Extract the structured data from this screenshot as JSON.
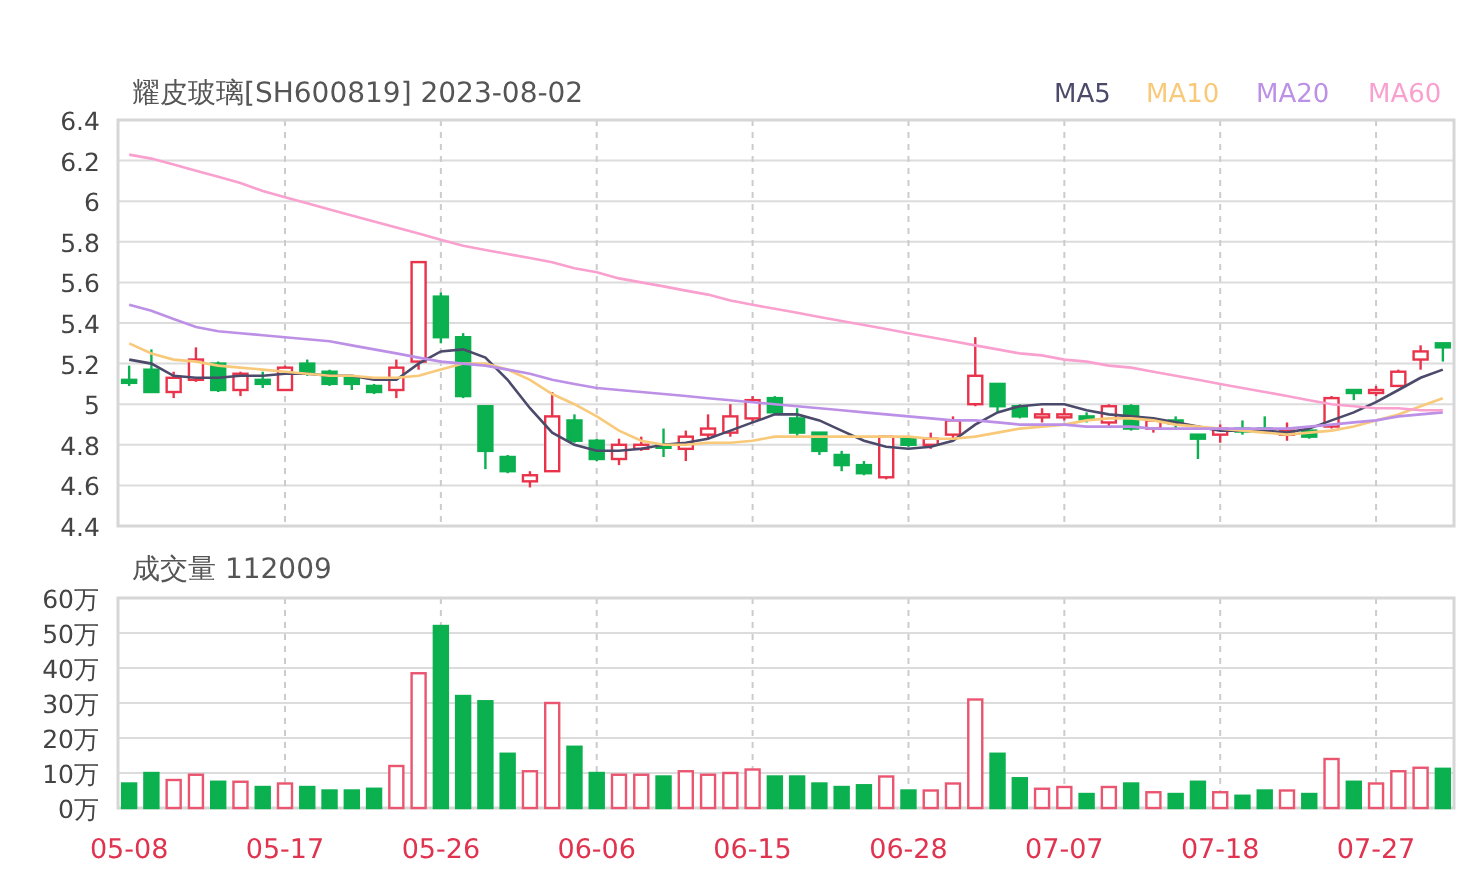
{
  "price_chart": {
    "chart_data": {
      "type": "candlestick",
      "title": "耀皮玻璃[SH600819] 2023-08-02",
      "ylim": [
        4.4,
        6.4
      ],
      "grid": true,
      "yticks": [
        4.4,
        4.6,
        4.8,
        5,
        5.2,
        5.4,
        5.6,
        5.8,
        6,
        6.2,
        6.4
      ],
      "categories": [
        null,
        null,
        null,
        null,
        null,
        null,
        null,
        null,
        null,
        null,
        null,
        null,
        null,
        null,
        null,
        null,
        null,
        null,
        null,
        null,
        null,
        null,
        null,
        null,
        null,
        null,
        null,
        null,
        null,
        null,
        null,
        null,
        null,
        null,
        null,
        null,
        null,
        null,
        null,
        null,
        null,
        null,
        null,
        null,
        null,
        null,
        null,
        null,
        null,
        null,
        null,
        null,
        null,
        null,
        null,
        null,
        null,
        null,
        null,
        null
      ],
      "ohlc": [
        [
          5.12,
          5.19,
          5.09,
          5.11
        ],
        [
          5.17,
          5.27,
          5.06,
          5.06
        ],
        [
          5.06,
          5.16,
          5.03,
          5.13
        ],
        [
          5.12,
          5.28,
          5.11,
          5.22
        ],
        [
          5.2,
          5.21,
          5.06,
          5.07
        ],
        [
          5.07,
          5.16,
          5.04,
          5.15
        ],
        [
          5.12,
          5.16,
          5.08,
          5.1
        ],
        [
          5.07,
          5.19,
          5.07,
          5.18
        ],
        [
          5.2,
          5.22,
          5.14,
          5.16
        ],
        [
          5.16,
          5.17,
          5.09,
          5.1
        ],
        [
          5.13,
          5.14,
          5.07,
          5.1
        ],
        [
          5.09,
          5.1,
          5.05,
          5.06
        ],
        [
          5.07,
          5.22,
          5.03,
          5.18
        ],
        [
          5.21,
          5.7,
          5.17,
          5.7
        ],
        [
          5.53,
          5.55,
          5.3,
          5.33
        ],
        [
          5.33,
          5.35,
          5.03,
          5.04
        ],
        [
          4.99,
          4.99,
          4.68,
          4.77
        ],
        [
          4.74,
          4.75,
          4.66,
          4.67
        ],
        [
          4.62,
          4.67,
          4.59,
          4.65
        ],
        [
          4.67,
          5.06,
          4.67,
          4.94
        ],
        [
          4.92,
          4.95,
          4.81,
          4.82
        ],
        [
          4.82,
          4.83,
          4.72,
          4.73
        ],
        [
          4.73,
          4.83,
          4.7,
          4.8
        ],
        [
          4.78,
          4.84,
          4.77,
          4.8
        ],
        [
          4.8,
          4.88,
          4.74,
          4.79
        ],
        [
          4.78,
          4.87,
          4.72,
          4.84
        ],
        [
          4.85,
          4.95,
          4.83,
          4.88
        ],
        [
          4.86,
          5,
          4.84,
          4.94
        ],
        [
          4.93,
          5.04,
          4.91,
          5.02
        ],
        [
          5.03,
          5.04,
          4.95,
          4.96
        ],
        [
          4.93,
          4.98,
          4.84,
          4.86
        ],
        [
          4.86,
          4.86,
          4.75,
          4.77
        ],
        [
          4.75,
          4.77,
          4.67,
          4.7
        ],
        [
          4.7,
          4.72,
          4.65,
          4.66
        ],
        [
          4.64,
          4.84,
          4.63,
          4.84
        ],
        [
          4.83,
          4.84,
          4.79,
          4.8
        ],
        [
          4.8,
          4.86,
          4.78,
          4.83
        ],
        [
          4.85,
          4.94,
          4.83,
          4.92
        ],
        [
          5,
          5.33,
          4.99,
          5.14
        ],
        [
          5.1,
          5.1,
          4.96,
          4.99
        ],
        [
          4.99,
          5,
          4.93,
          4.94
        ],
        [
          4.94,
          4.98,
          4.91,
          4.95
        ],
        [
          4.94,
          4.98,
          4.92,
          4.95
        ],
        [
          4.94,
          4.96,
          4.91,
          4.93
        ],
        [
          4.91,
          5,
          4.89,
          4.99
        ],
        [
          4.99,
          5,
          4.87,
          4.88
        ],
        [
          4.88,
          4.93,
          4.86,
          4.92
        ],
        [
          4.92,
          4.94,
          4.88,
          4.91
        ],
        [
          4.85,
          4.85,
          4.73,
          4.83
        ],
        [
          4.85,
          4.9,
          4.81,
          4.88
        ],
        [
          4.88,
          4.92,
          4.85,
          4.87
        ],
        [
          4.88,
          4.94,
          4.86,
          4.87
        ],
        [
          4.85,
          4.91,
          4.82,
          4.87
        ],
        [
          4.87,
          4.87,
          4.83,
          4.84
        ],
        [
          4.89,
          5.04,
          4.88,
          5.03
        ],
        [
          5.07,
          5.07,
          5.02,
          5.06
        ],
        [
          5.06,
          5.09,
          5.04,
          5.07
        ],
        [
          5.09,
          5.17,
          5.09,
          5.16
        ],
        [
          5.22,
          5.29,
          5.17,
          5.26
        ],
        [
          5.3,
          5.3,
          5.21,
          5.28
        ]
      ]
    }
  },
  "moving_averages": {
    "chart_data": {
      "type": "line",
      "ylim": [
        4.4,
        6.4
      ],
      "categories": [
        null,
        null,
        null,
        null,
        null,
        null,
        null,
        null,
        null,
        null,
        null,
        null,
        null,
        null,
        null,
        null,
        null,
        null,
        null,
        null,
        null,
        null,
        null,
        null,
        null,
        null,
        null,
        null,
        null,
        null,
        null,
        null,
        null,
        null,
        null,
        null,
        null,
        null,
        null,
        null,
        null,
        null,
        null,
        null,
        null,
        null,
        null,
        null,
        null,
        null,
        null,
        null,
        null,
        null,
        null,
        null,
        null,
        null,
        null,
        null
      ],
      "series": [
        {
          "name": "MA5",
          "color": "#4b4a6b",
          "values": [
            5.22,
            5.2,
            5.14,
            5.13,
            5.13,
            5.14,
            5.14,
            5.15,
            5.15,
            5.14,
            5.14,
            5.12,
            5.12,
            5.2,
            5.26,
            5.27,
            5.23,
            5.12,
            4.98,
            4.86,
            4.8,
            4.77,
            4.77,
            4.78,
            4.8,
            4.81,
            4.83,
            4.87,
            4.91,
            4.95,
            4.95,
            4.92,
            4.87,
            4.82,
            4.79,
            4.78,
            4.79,
            4.82,
            4.9,
            4.96,
            4.99,
            5,
            5,
            4.97,
            4.95,
            4.94,
            4.93,
            4.91,
            4.89,
            4.87,
            4.87,
            4.87,
            4.86,
            4.88,
            4.92,
            4.96,
            5.01,
            5.07,
            5.13,
            5.17
          ]
        },
        {
          "name": "MA10",
          "color": "#f9c97a",
          "values": [
            5.3,
            5.25,
            5.22,
            5.21,
            5.19,
            5.18,
            5.17,
            5.16,
            5.15,
            5.14,
            5.14,
            5.13,
            5.13,
            5.14,
            5.17,
            5.2,
            5.2,
            5.17,
            5.12,
            5.05,
            5,
            4.94,
            4.87,
            4.82,
            4.8,
            4.8,
            4.81,
            4.81,
            4.82,
            4.84,
            4.84,
            4.84,
            4.84,
            4.84,
            4.84,
            4.84,
            4.83,
            4.83,
            4.84,
            4.86,
            4.88,
            4.89,
            4.9,
            4.92,
            4.93,
            4.93,
            4.92,
            4.9,
            4.89,
            4.88,
            4.87,
            4.86,
            4.85,
            4.86,
            4.87,
            4.89,
            4.92,
            4.95,
            4.99,
            5.03
          ]
        },
        {
          "name": "MA20",
          "color": "#bc90e6",
          "values": [
            5.49,
            5.46,
            5.42,
            5.38,
            5.36,
            5.35,
            5.34,
            5.33,
            5.32,
            5.31,
            5.29,
            5.27,
            5.25,
            5.23,
            5.21,
            5.2,
            5.19,
            5.17,
            5.15,
            5.12,
            5.1,
            5.08,
            5.07,
            5.06,
            5.05,
            5.04,
            5.03,
            5.02,
            5.01,
            5,
            4.99,
            4.98,
            4.97,
            4.96,
            4.95,
            4.94,
            4.93,
            4.92,
            4.92,
            4.91,
            4.9,
            4.9,
            4.9,
            4.89,
            4.89,
            4.89,
            4.88,
            4.88,
            4.88,
            4.88,
            4.88,
            4.88,
            4.88,
            4.89,
            4.9,
            4.91,
            4.92,
            4.94,
            4.95,
            4.96
          ]
        },
        {
          "name": "MA60",
          "color": "#f9a0cf",
          "values": [
            6.23,
            6.21,
            6.18,
            6.15,
            6.12,
            6.09,
            6.05,
            6.02,
            5.99,
            5.96,
            5.93,
            5.9,
            5.87,
            5.84,
            5.81,
            5.78,
            5.76,
            5.74,
            5.72,
            5.7,
            5.67,
            5.65,
            5.62,
            5.6,
            5.58,
            5.56,
            5.54,
            5.51,
            5.49,
            5.47,
            5.45,
            5.43,
            5.41,
            5.39,
            5.37,
            5.35,
            5.33,
            5.31,
            5.29,
            5.27,
            5.25,
            5.24,
            5.22,
            5.21,
            5.19,
            5.18,
            5.16,
            5.14,
            5.12,
            5.1,
            5.08,
            5.06,
            5.04,
            5.02,
            5,
            4.99,
            4.98,
            4.98,
            4.97,
            4.97
          ]
        }
      ]
    }
  },
  "volume_chart": {
    "chart_data": {
      "type": "bar",
      "title": "成交量 112009",
      "ylim": [
        0,
        60
      ],
      "grid": true,
      "yticks": [
        {
          "value": 0,
          "label": "0万"
        },
        {
          "value": 10,
          "label": "10万"
        },
        {
          "value": 20,
          "label": "20万"
        },
        {
          "value": 30,
          "label": "30万"
        },
        {
          "value": 40,
          "label": "40万"
        },
        {
          "value": 50,
          "label": "50万"
        },
        {
          "value": 60,
          "label": "60万"
        }
      ],
      "categories": [
        "05-08",
        null,
        null,
        null,
        null,
        null,
        null,
        "05-17",
        null,
        null,
        null,
        null,
        null,
        null,
        "05-26",
        null,
        null,
        null,
        null,
        null,
        null,
        "06-06",
        null,
        null,
        null,
        null,
        null,
        null,
        "06-15",
        null,
        null,
        null,
        null,
        null,
        null,
        "06-28",
        null,
        null,
        null,
        null,
        null,
        null,
        "07-07",
        null,
        null,
        null,
        null,
        null,
        null,
        "07-18",
        null,
        null,
        null,
        null,
        null,
        null,
        "07-27",
        null,
        null,
        null
      ],
      "values": [
        7,
        10,
        8,
        9.5,
        7.5,
        7.5,
        6,
        7,
        6,
        5,
        5,
        5.5,
        12,
        38.5,
        52,
        32,
        30.5,
        15.5,
        10.5,
        30,
        17.5,
        10,
        9.5,
        9.5,
        9,
        10.5,
        9.5,
        10,
        11,
        9,
        9,
        7,
        6,
        6.5,
        9,
        5,
        5,
        7,
        31,
        15.5,
        8.5,
        5.5,
        6,
        4,
        6,
        7,
        4.5,
        4,
        7.5,
        4.5,
        3.5,
        5,
        5,
        4,
        14,
        7.5,
        7,
        10.5,
        11.5,
        11.2
      ]
    }
  }
}
